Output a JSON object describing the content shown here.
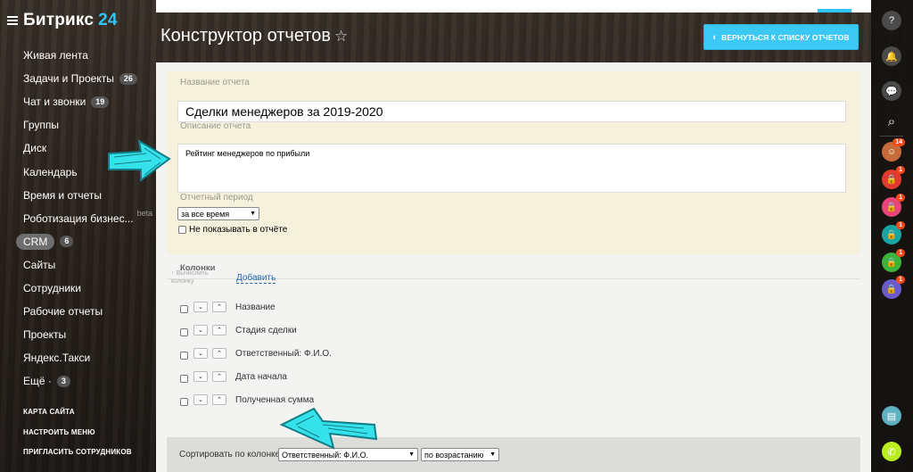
{
  "sidebar": {
    "logo_name": "Битрикс",
    "logo_num": "24",
    "items": [
      {
        "label": "Живая лента",
        "counter": ""
      },
      {
        "label": "Задачи и Проекты",
        "counter": "26"
      },
      {
        "label": "Чат и звонки",
        "counter": "19"
      },
      {
        "label": "Группы",
        "counter": ""
      },
      {
        "label": "Диск",
        "counter": ""
      },
      {
        "label": "Календарь",
        "counter": ""
      },
      {
        "label": "Время и отчеты",
        "counter": ""
      },
      {
        "label": "Роботизация бизнес...",
        "counter": "",
        "tag": "beta"
      },
      {
        "label": "CRM",
        "counter": "6"
      },
      {
        "label": "Сайты",
        "counter": ""
      },
      {
        "label": "Сотрудники",
        "counter": ""
      },
      {
        "label": "Рабочие отчеты",
        "counter": ""
      },
      {
        "label": "Проекты",
        "counter": ""
      },
      {
        "label": "Яндекс.Такси",
        "counter": ""
      },
      {
        "label": "Ещё ·",
        "counter": "3"
      }
    ],
    "links": [
      "КАРТА САЙТА",
      "НАСТРОИТЬ МЕНЮ",
      "ПРИГЛАСИТЬ СОТРУДНИКОВ"
    ]
  },
  "rightbar": {
    "icons": [
      {
        "name": "help-icon",
        "glyph": "?"
      },
      {
        "name": "bell-icon",
        "glyph": "🔔"
      },
      {
        "name": "chat-icon",
        "glyph": "💬"
      },
      {
        "name": "search-icon",
        "glyph": "⌕"
      }
    ],
    "contacts": [
      {
        "color": "#c86b3a",
        "badge": "14",
        "glyph": "☺"
      },
      {
        "color": "#e03b2e",
        "badge": "1",
        "glyph": "🔒"
      },
      {
        "color": "#e8457a",
        "badge": "1",
        "glyph": "🔒"
      },
      {
        "color": "#1aa3a3",
        "badge": "1",
        "glyph": "🔒"
      },
      {
        "color": "#3cb43c",
        "badge": "1",
        "glyph": "🔒"
      },
      {
        "color": "#6a5acd",
        "badge": "1",
        "glyph": "🔒"
      }
    ]
  },
  "header": {
    "title": "Конструктор отчетов",
    "star": "☆",
    "back_button": "ВЕРНУТЬСЯ К СПИСКУ ОТЧЕТОВ",
    "back_chevron": "‹"
  },
  "form": {
    "name_label": "Название отчета",
    "name_value": "Сделки менеджеров за 2019-2020",
    "desc_label": "Описание отчета",
    "desc_value": "Рейтинг менеджеров по прибыли",
    "period_label": "Отчетный период",
    "period_value": "за все время",
    "hide_label": "Не показывать в отчёте"
  },
  "columns": {
    "title": "Колонки",
    "rows": [
      "Название",
      "Стадия сделки",
      "Ответственный: Ф.И.О.",
      "Дата начала",
      "Полученная сумма"
    ],
    "down_glyph": "⌄",
    "up_glyph": "⌃",
    "calc_hint": "Вычислить колонку",
    "add_link": "Добавить"
  },
  "sort": {
    "label": "Сортировать по колонке",
    "column_value": "Ответственный: Ф.И.О.",
    "order_value": "по возрастанию"
  }
}
